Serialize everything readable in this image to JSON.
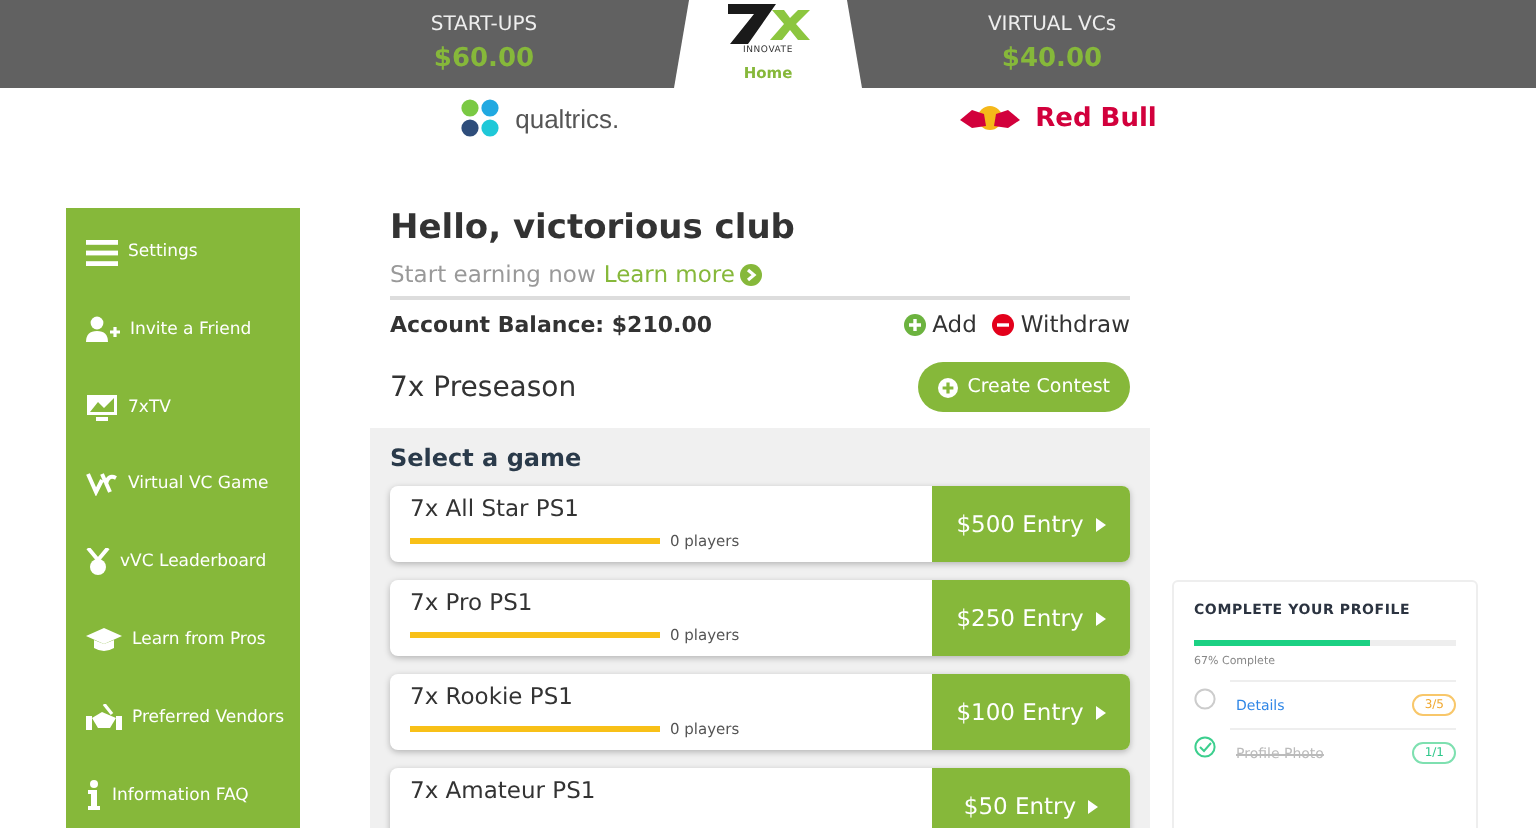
{
  "header": {
    "left": {
      "label": "START-UPS",
      "amount": "$60.00"
    },
    "logo_caption": "INNOVATE",
    "home": "Home",
    "right": {
      "label": "VIRTUAL VCs",
      "amount": "$40.00"
    }
  },
  "sponsors": [
    {
      "kind": "qualtrics",
      "name": "qualtrics."
    },
    {
      "kind": "redbull",
      "name": "Red Bull"
    }
  ],
  "sidebar": {
    "items": [
      {
        "kind": "menu",
        "label": "Settings"
      },
      {
        "kind": "invite",
        "label": "Invite a Friend"
      },
      {
        "kind": "tv",
        "label": "7xTV"
      },
      {
        "kind": "vc",
        "label": "Virtual VC Game"
      },
      {
        "kind": "medal",
        "label": "vVC Leaderboard"
      },
      {
        "kind": "cap",
        "label": "Learn from Pros"
      },
      {
        "kind": "vendors",
        "label": "Preferred Vendors"
      },
      {
        "kind": "info",
        "label": "Information FAQ"
      }
    ]
  },
  "greeting": "Hello, victorious club",
  "tagline": "Start earning now",
  "learn_more": "Learn more",
  "balance": "Account Balance: $210.00",
  "add": "Add",
  "withdraw": "Withdraw",
  "season": "7x Preseason",
  "create_contest": "Create Contest",
  "games_title": "Select a game",
  "games": [
    {
      "name": "7x All Star PS1",
      "players": "0 players",
      "entry": "$500 Entry"
    },
    {
      "name": "7x Pro PS1",
      "players": "0 players",
      "entry": "$250 Entry"
    },
    {
      "name": "7x Rookie PS1",
      "players": "0 players",
      "entry": "$100 Entry"
    },
    {
      "name": "7x Amateur PS1",
      "entry": "$50 Entry"
    }
  ],
  "profile": {
    "title": "COMPLETE YOUR PROFILE",
    "level": 0.67,
    "caption": "67% Complete",
    "items": [
      {
        "label": "Details",
        "badge": "3/5",
        "checked": false
      },
      {
        "label": "Profile Photo",
        "badge": "1/1",
        "checked": true
      }
    ]
  }
}
